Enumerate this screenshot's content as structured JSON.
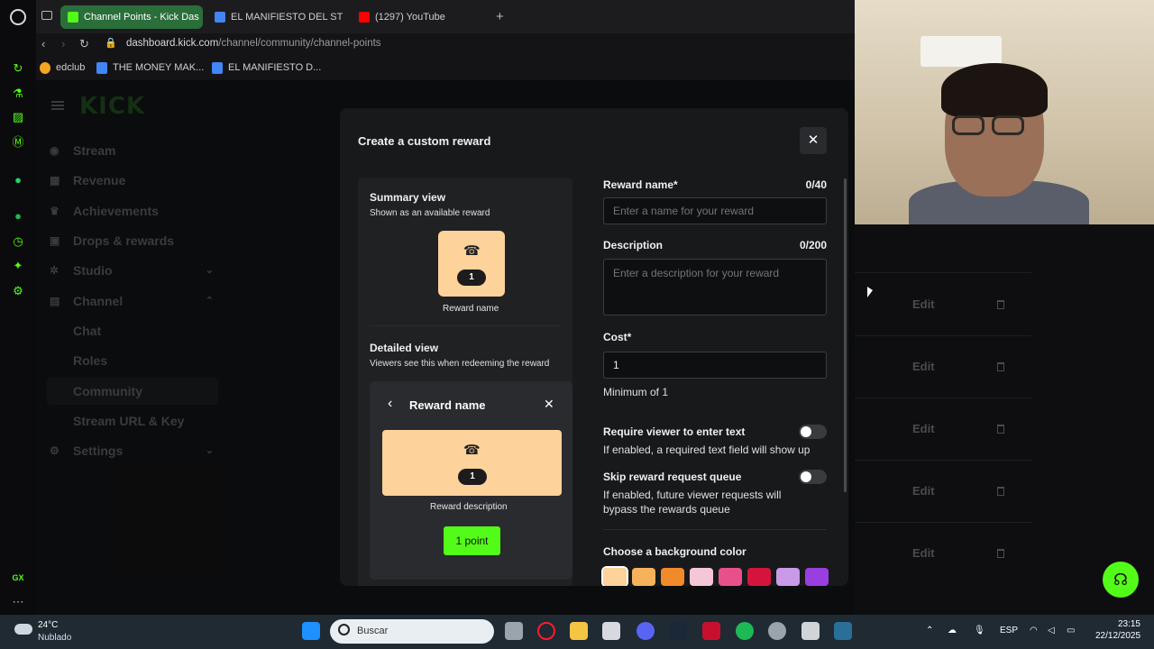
{
  "browser": {
    "tabs": [
      {
        "label": "Channel Points - Kick Das",
        "color": "#53fc18"
      },
      {
        "label": "EL MANIFIESTO DEL STR",
        "color": "#4285f4"
      },
      {
        "label": "(1297) YouTube",
        "color": "#ff0000"
      }
    ],
    "url_domain": "dashboard.kick.com",
    "url_path": "/channel/community/channel-points",
    "bookmarks": [
      {
        "label": "edclub",
        "color": "#f6a623"
      },
      {
        "label": "THE MONEY MAK...",
        "color": "#4285f4"
      },
      {
        "label": "EL MANIFIESTO D...",
        "color": "#4285f4"
      }
    ]
  },
  "sidebar": {
    "logo": "KICK",
    "items": [
      {
        "label": "Stream",
        "icon": "broadcast-icon"
      },
      {
        "label": "Revenue",
        "icon": "revenue-icon"
      },
      {
        "label": "Achievements",
        "icon": "trophy-icon"
      },
      {
        "label": "Drops & rewards",
        "icon": "gift-icon"
      },
      {
        "label": "Studio",
        "icon": "studio-icon",
        "chevron": "⌄"
      },
      {
        "label": "Channel",
        "icon": "channel-icon",
        "chevron": "⌃"
      },
      {
        "label": "Chat"
      },
      {
        "label": "Roles"
      },
      {
        "label": "Community"
      },
      {
        "label": "Stream URL & Key"
      },
      {
        "label": "Settings",
        "icon": "gear-icon",
        "chevron": "⌄"
      }
    ]
  },
  "list": {
    "edit_label": "Edit"
  },
  "modal": {
    "title": "Create a custom reward",
    "preview": {
      "summary_title": "Summary view",
      "summary_sub": "Shown as an available reward",
      "tile_cost": "1",
      "tile_name": "Reward name",
      "detailed_title": "Detailed view",
      "detailed_sub": "Viewers see this when redeeming the reward",
      "card_title": "Reward name",
      "card_desc": "Reward description",
      "point_button": "1 point",
      "tile_color": "#fdd29b"
    },
    "form": {
      "name_label": "Reward name*",
      "name_count": "0/40",
      "name_placeholder": "Enter a name for your reward",
      "desc_label": "Description",
      "desc_count": "0/200",
      "desc_placeholder": "Enter a description for your reward",
      "cost_label": "Cost*",
      "cost_value": "1",
      "cost_help": "Minimum of 1",
      "require_text_label": "Require viewer to enter text",
      "require_text_help": "If enabled, a required text field will show up",
      "require_text_on": false,
      "skip_queue_label": "Skip reward request queue",
      "skip_queue_help": "If enabled, future viewer requests will bypass the rewards queue",
      "skip_queue_on": false,
      "bg_color_label": "Choose a background color",
      "swatches": [
        "#fdd29b",
        "#f6b25a",
        "#f08a2a",
        "#f5c6d6",
        "#e8508a",
        "#d4143c",
        "#c89ae8",
        "#9a3ee0"
      ]
    }
  },
  "taskbar": {
    "temp": "24°C",
    "condition": "Nublado",
    "search_placeholder": "Buscar",
    "lang": "ESP",
    "time": "23:15",
    "date": "22/12/2025"
  }
}
